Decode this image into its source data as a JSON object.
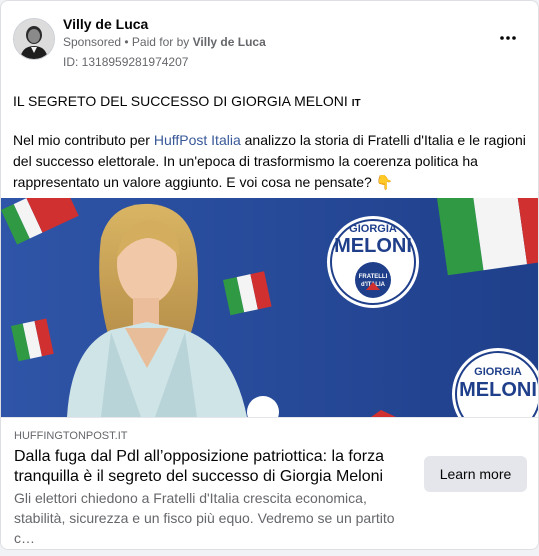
{
  "header": {
    "author": "Villy de Luca",
    "sponsored": "Sponsored",
    "separator": " • ",
    "paid_for_prefix": "Paid for by ",
    "paid_for_name": "Villy de Luca",
    "ad_id": "ID: 1318959281974207",
    "more_icon": "more-horizontal-icon"
  },
  "post": {
    "title": "IL SEGRETO DEL SUCCESSO DI GIORGIA MELONI",
    "flag": "IT",
    "body_before_link": "Nel mio contributo per ",
    "link_text": "HuffPost Italia",
    "body_after_link": " analizzo la storia di Fratelli d'Italia e le ragioni del successo elettorale. In un'epoca di trasformismo la coerenza politica ha rappresentato un valore aggiunto. E voi cosa ne pensate?",
    "emoji": "👇"
  },
  "media": {
    "banner_top": "GIORGIA",
    "banner_name": "MELONI",
    "banner_party_1": "FRATELLI",
    "banner_party_2": "d'ITALIA"
  },
  "link_preview": {
    "domain": "HUFFINGTONPOST.IT",
    "headline": "Dalla fuga dal Pdl all’opposizione patriottica: la forza tranquilla è il segreto del successo di Giorgia Meloni",
    "description": "Gli elettori chiedono a Fratelli d'Italia crescita economica, stabilità, sicurezza e un fisco più equo. Vedremo se un partito c…",
    "cta": "Learn more"
  }
}
